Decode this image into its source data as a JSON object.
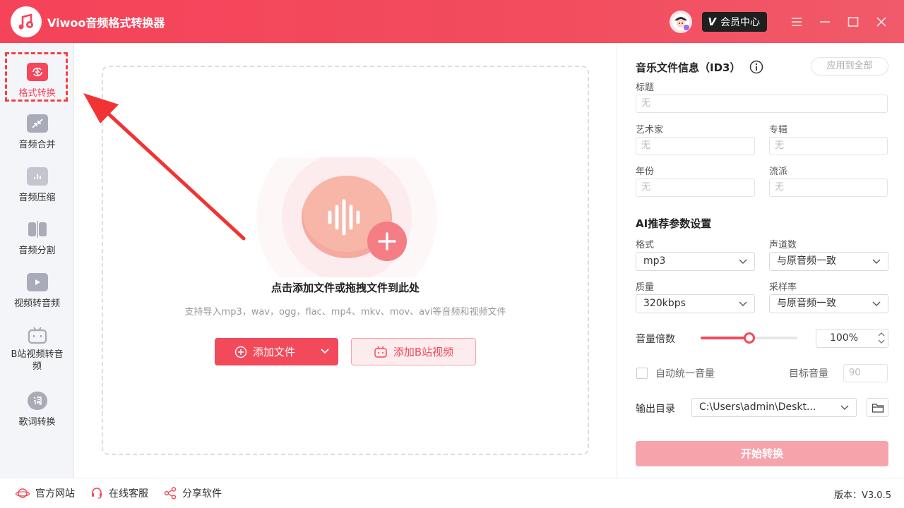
{
  "app": {
    "title": "Viwoo音频格式转换器",
    "vip_mark": "V",
    "vip_label": "会员中心",
    "brand_color": "#f4475c"
  },
  "sidebar": {
    "items": [
      {
        "label": "格式转换",
        "icon": "convert-icon",
        "active": true
      },
      {
        "label": "音频合并",
        "icon": "merge-icon"
      },
      {
        "label": "音频压缩",
        "icon": "compress-icon"
      },
      {
        "label": "音频分割",
        "icon": "split-icon"
      },
      {
        "label": "视频转音频",
        "icon": "video-icon"
      },
      {
        "label": "B站视频转音频",
        "icon": "bilibili-icon"
      },
      {
        "label": "歌词转换",
        "icon": "lyrics-icon"
      }
    ]
  },
  "dropzone": {
    "title": "点击添加文件或拖拽文件到此处",
    "subtitle": "支持导入mp3，wav，ogg，flac、mp4、mkv、mov、avi等音频和视频文件",
    "add_file_label": "添加文件",
    "add_bili_label": "添加B站视频"
  },
  "id3": {
    "section_title": "音乐文件信息（ID3）",
    "apply_all_label": "应用到全部",
    "title_label": "标题",
    "title_value": "无",
    "artist_label": "艺术家",
    "artist_value": "无",
    "album_label": "专辑",
    "album_value": "无",
    "year_label": "年份",
    "year_value": "无",
    "genre_label": "流派",
    "genre_value": "无"
  },
  "settings": {
    "section_title": "AI推荐参数设置",
    "format_label": "格式",
    "format_value": "mp3",
    "channels_label": "声道数",
    "channels_value": "与原音频一致",
    "quality_label": "质量",
    "quality_value": "320kbps",
    "samplerate_label": "采样率",
    "samplerate_value": "与原音频一致",
    "volume_label": "音量倍数",
    "volume_value": "100%",
    "volume_slider_fraction": 0.5,
    "auto_volume_label": "自动统一音量",
    "auto_volume_checked": false,
    "target_volume_label": "目标音量",
    "target_volume_value": "90",
    "output_label": "输出目录",
    "output_value": "C:\\Users\\admin\\Deskt...",
    "start_label": "开始转换"
  },
  "footer": {
    "website_label": "官方网站",
    "support_label": "在线客服",
    "share_label": "分享软件",
    "version_label": "版本：V3.0.5"
  }
}
